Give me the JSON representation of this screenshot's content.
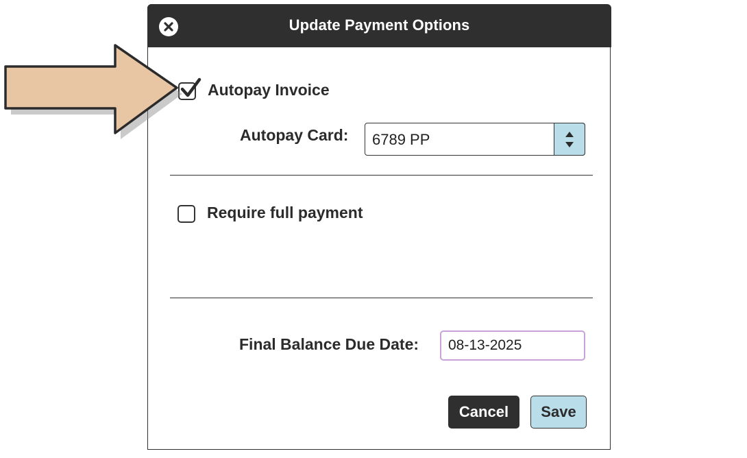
{
  "dialog": {
    "title": "Update Payment Options",
    "close_icon": "close-icon"
  },
  "autopay": {
    "label": "Autopay Invoice",
    "checked": true,
    "card_label": "Autopay Card:",
    "card_value": "6789 PP"
  },
  "full_payment": {
    "label": "Require full payment",
    "checked": false
  },
  "due_date": {
    "label": "Final Balance Due Date:",
    "value": "08-13-2025"
  },
  "buttons": {
    "cancel": "Cancel",
    "save": "Save"
  },
  "annotation": {
    "icon": "pointer-arrow-icon",
    "color": "#e9c6a3"
  },
  "colors": {
    "titlebar": "#2f2f2f",
    "accent": "#b9dde9",
    "date_border": "#c8a3d8"
  }
}
